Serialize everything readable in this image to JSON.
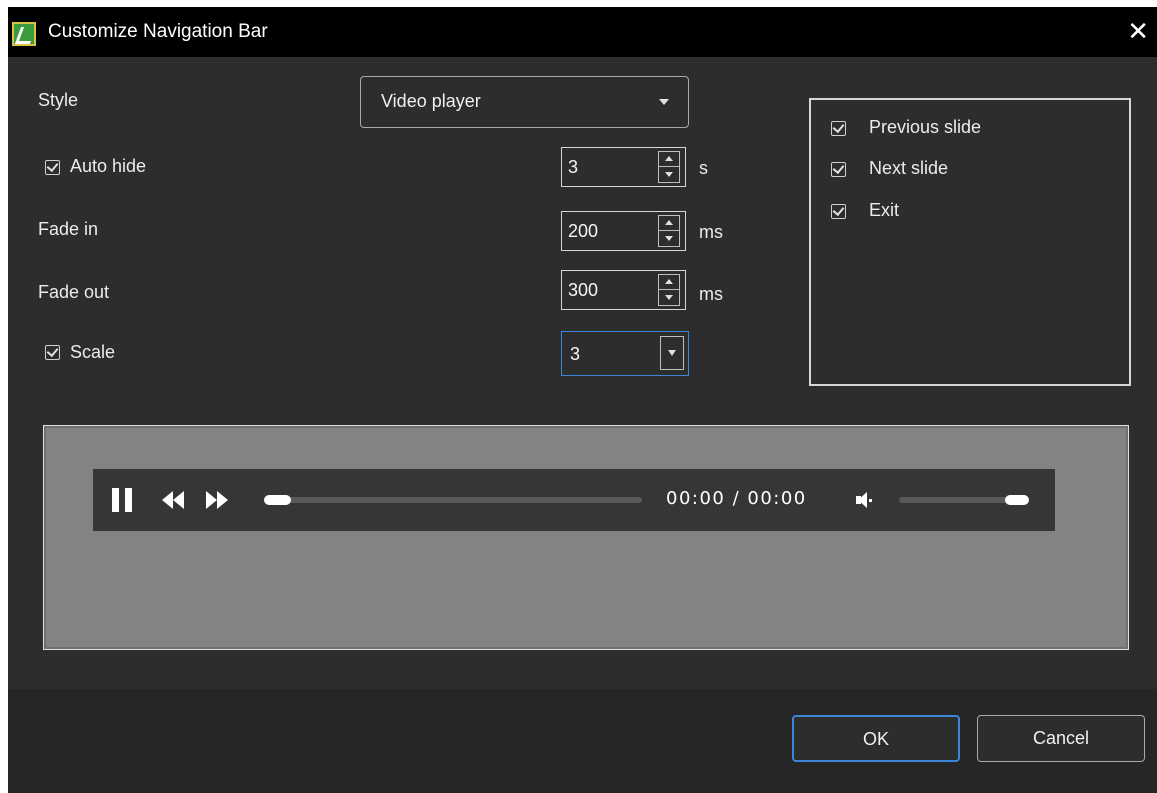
{
  "window": {
    "title": "Customize Navigation Bar",
    "close_label": "✕"
  },
  "style": {
    "label": "Style",
    "selected": "Video player"
  },
  "auto_hide": {
    "label": "Auto hide",
    "checked": true,
    "value": "3",
    "unit": "s"
  },
  "fade_in": {
    "label": "Fade in",
    "value": "200",
    "unit": "ms"
  },
  "fade_out": {
    "label": "Fade out",
    "value": "300",
    "unit": "ms"
  },
  "scale": {
    "label": "Scale",
    "checked": true,
    "value": "3"
  },
  "buttons_list": {
    "items": [
      {
        "label": "Previous slide",
        "checked": true
      },
      {
        "label": "Next slide",
        "checked": true
      },
      {
        "label": "Exit",
        "checked": true
      }
    ]
  },
  "preview": {
    "time": "00:00 / 00:00",
    "progress": 0.0,
    "volume": 1.0,
    "icons": [
      "pause-icon",
      "rewind-icon",
      "fast-forward-icon",
      "volume-icon"
    ]
  },
  "footer": {
    "ok_label": "OK",
    "cancel_label": "Cancel"
  },
  "colors": {
    "background": "#2d2d2d",
    "titlebar": "#000000",
    "accent": "#3a87d8",
    "preview_bg": "#838383",
    "navbar_bg": "#363636"
  }
}
